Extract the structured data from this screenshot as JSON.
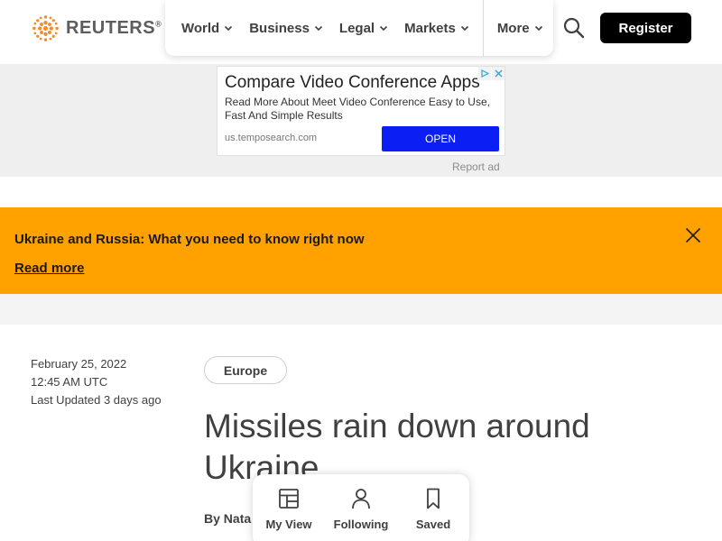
{
  "header": {
    "logo_text": "REUTERS",
    "logo_reg": "®",
    "nav": [
      {
        "label": "World"
      },
      {
        "label": "Business"
      },
      {
        "label": "Legal"
      },
      {
        "label": "Markets"
      },
      {
        "label": "More"
      }
    ],
    "register_label": "Register"
  },
  "ad": {
    "title": "Compare Video Conference Apps",
    "description": "Read More About Meet Video Conference Easy to Use, Fast And Simple Results",
    "url": "us.temposearch.com",
    "cta": "OPEN",
    "report_label": "Report ad"
  },
  "alert": {
    "title": "Ukraine and Russia: What you need to know right now",
    "link": "Read more"
  },
  "article": {
    "date": "February 25, 2022",
    "time": "12:45 AM UTC",
    "updated": "Last Updated 3 days ago",
    "tag": "Europe",
    "headline": "Missiles rain down around Ukraine",
    "byline_prefix": "By",
    "byline_name": "Nata"
  },
  "floating_bar": {
    "items": [
      {
        "label": "My View",
        "icon": "layout-icon"
      },
      {
        "label": "Following",
        "icon": "person-icon"
      },
      {
        "label": "Saved",
        "icon": "bookmark-icon"
      }
    ]
  },
  "colors": {
    "alert_bg": "#ffa200",
    "ad_open_button": "#0b1ff5",
    "register_bg": "#000000",
    "logo_orange": "#f28c28"
  }
}
